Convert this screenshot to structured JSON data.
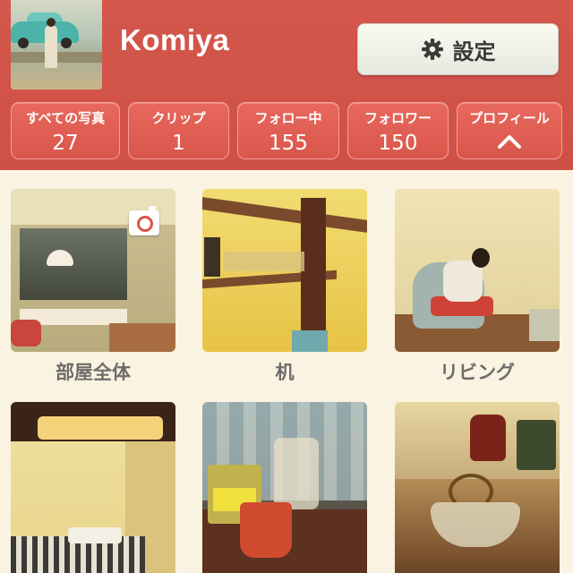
{
  "profile": {
    "username": "Komiya",
    "settings_label": "設定"
  },
  "stats": [
    {
      "label": "すべての写真",
      "value": "27"
    },
    {
      "label": "クリップ",
      "value": "1"
    },
    {
      "label": "フォロー中",
      "value": "155"
    },
    {
      "label": "フォロワー",
      "value": "150"
    }
  ],
  "profile_tab": {
    "label": "プロフィール",
    "icon": "chevron-up-icon"
  },
  "albums": [
    {
      "caption": "部屋全体"
    },
    {
      "caption": "机"
    },
    {
      "caption": "リビング"
    }
  ],
  "icons": {
    "settings": "gear-icon",
    "album_badge": "camera-icon"
  },
  "colors": {
    "header_bg": "#d4574c",
    "stat_bg": "#e2605a",
    "caption_text": "#6d6c6a",
    "page_bg": "#faf3e2"
  }
}
